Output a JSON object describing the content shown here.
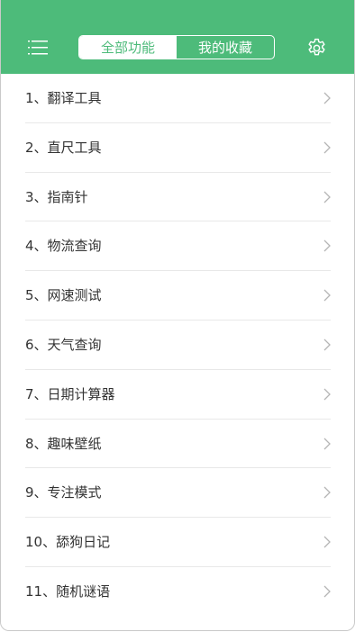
{
  "colors": {
    "brand": "#4dbb7a",
    "text": "#333333",
    "chevron": "#b5b5b5",
    "divider": "#e8e8e8"
  },
  "header": {
    "menu_icon": "hamburger-menu-icon",
    "tabs": [
      {
        "label": "全部功能",
        "active": true
      },
      {
        "label": "我的收藏",
        "active": false
      }
    ],
    "settings_icon": "gear-icon"
  },
  "list": {
    "items": [
      {
        "label": "1、翻译工具"
      },
      {
        "label": "2、直尺工具"
      },
      {
        "label": "3、指南针"
      },
      {
        "label": "4、物流查询"
      },
      {
        "label": "5、网速测试"
      },
      {
        "label": "6、天气查询"
      },
      {
        "label": "7、日期计算器"
      },
      {
        "label": "8、趣味壁纸"
      },
      {
        "label": "9、专注模式"
      },
      {
        "label": "10、舔狗日记"
      },
      {
        "label": "11、随机谜语"
      }
    ],
    "item_icon": "chevron-right-icon"
  }
}
